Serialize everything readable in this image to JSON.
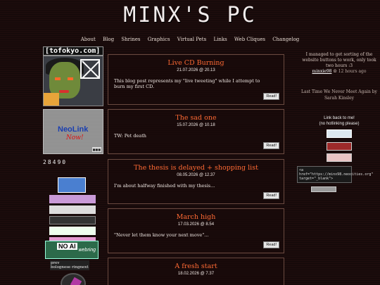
{
  "site": {
    "title": "MINX'S PC"
  },
  "nav": [
    "About",
    "Blog",
    "Shrines",
    "Graphics",
    "Virtual Pets",
    "Links",
    "Web Cliques",
    "Changelog"
  ],
  "left": {
    "site_label": "[tofokyo.com]",
    "neolink_title": "NeoLink",
    "neolink_sub": "Now!",
    "counter": "28490",
    "bologna": "prev\nbolognese ringnext"
  },
  "posts": [
    {
      "title": "Live CD Burning",
      "date": "21.07.2026 @ 20.13",
      "excerpt": "This blog post represents my \"live tweeting\" while I attempt to burn my first CD.",
      "read": "Read!"
    },
    {
      "title": "The sad one",
      "date": "15.07.2026 @ 10.18",
      "excerpt": "TW: Pet death",
      "read": "Read!"
    },
    {
      "title": "The thesis is delayed + shopping list",
      "date": "08.05.2026 @ 12.37",
      "excerpt": "I'm about halfway finished with my thesis...",
      "read": "Read!"
    },
    {
      "title": "March high",
      "date": "17.03.2026 @ 8.54",
      "excerpt": "\"Never let them know your next move\"...",
      "read": "Read!"
    },
    {
      "title": "A fresh start",
      "date": "18.02.2026 @ 7.37",
      "excerpt": "",
      "read": ""
    }
  ],
  "right": {
    "status_text": "I managed to get sorting of the website buttons to work, only took two hours :3",
    "status_user": "minxie98",
    "status_ago": "12 hours ago",
    "quote": "Last Time We Never Meet Again by Sarah Kinsley",
    "link_back_title": "Link back to me!",
    "link_back_sub": "(no hotlinking please)",
    "code": "<a href=\"https://minx98.neocities.org\" target=\"_blank\">"
  },
  "colors": {
    "background": "#1c0c0c",
    "accent": "#ff6a34",
    "border": "#6a4a40"
  }
}
